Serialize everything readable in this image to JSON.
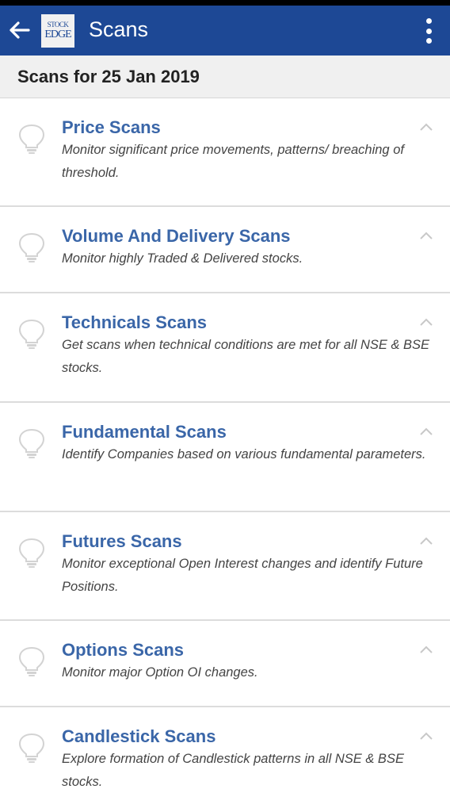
{
  "app_bar": {
    "title": "Scans",
    "logo_line1": "STOCK",
    "logo_line2": "EDGE",
    "back_icon": "arrow-left-icon",
    "menu_icon": "more-vertical-icon"
  },
  "date_header": "Scans for 25 Jan 2019",
  "colors": {
    "app_bar": "#1d4895",
    "title_accent": "#3a66a8",
    "header_bg": "#f0f0f0"
  },
  "scans": [
    {
      "title": "Price Scans",
      "description": "Monitor significant price movements, patterns/ breaching of threshold.",
      "icon": "lightbulb-icon",
      "expand_icon": "chevron-up-icon"
    },
    {
      "title": "Volume And Delivery Scans",
      "description": "Monitor highly Traded & Delivered stocks.",
      "icon": "lightbulb-icon",
      "expand_icon": "chevron-up-icon"
    },
    {
      "title": "Technicals Scans",
      "description": "Get scans when technical conditions are met for all NSE & BSE stocks.",
      "icon": "lightbulb-icon",
      "expand_icon": "chevron-up-icon"
    },
    {
      "title": "Fundamental Scans",
      "description": "Identify Companies based on various fundamental parameters.",
      "icon": "lightbulb-icon",
      "expand_icon": "chevron-up-icon"
    },
    {
      "title": "Futures Scans",
      "description": "Monitor exceptional Open Interest changes and identify Future Positions.",
      "icon": "lightbulb-icon",
      "expand_icon": "chevron-up-icon"
    },
    {
      "title": "Options Scans",
      "description": "Monitor major Option OI changes.",
      "icon": "lightbulb-icon",
      "expand_icon": "chevron-up-icon"
    },
    {
      "title": "Candlestick Scans",
      "description": "Explore formation of Candlestick patterns in all NSE & BSE stocks.",
      "icon": "lightbulb-icon",
      "expand_icon": "chevron-up-icon"
    }
  ]
}
